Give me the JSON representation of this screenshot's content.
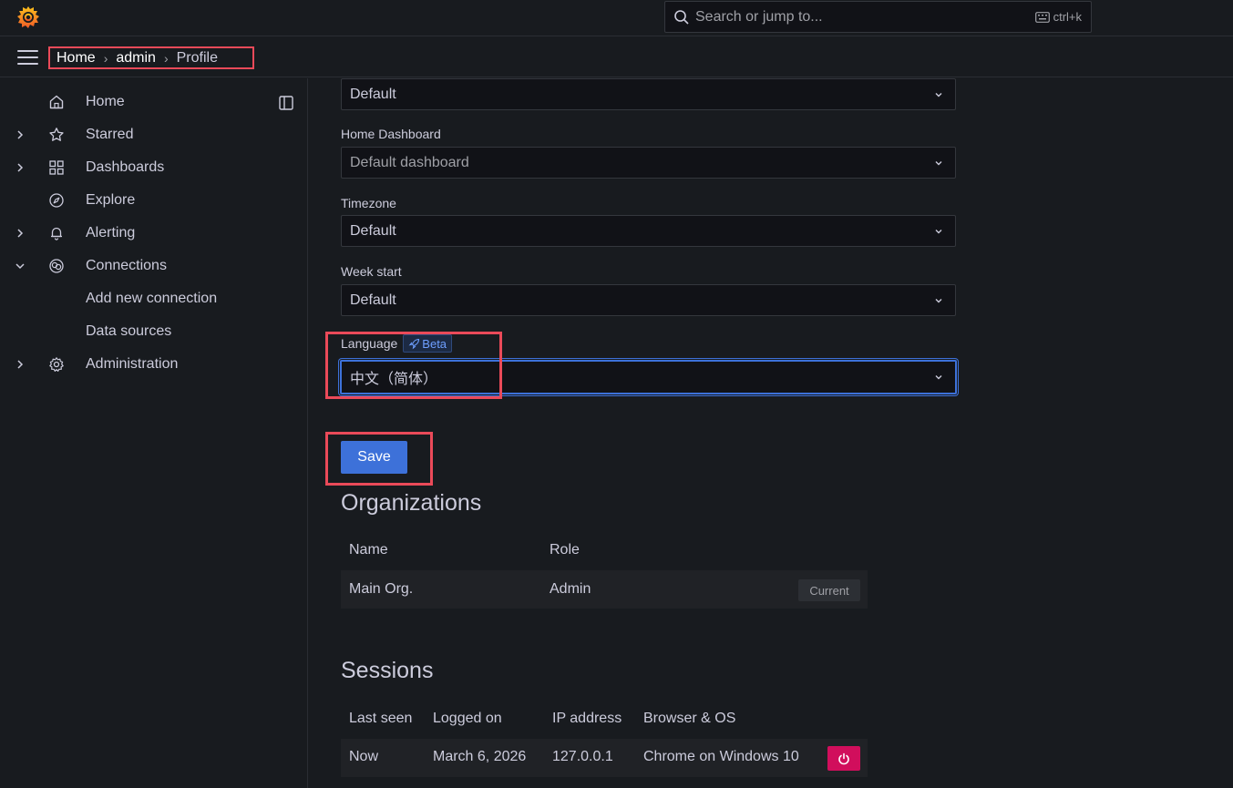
{
  "topbar": {
    "logo_icon": "grafana-logo",
    "search_placeholder": "Search or jump to...",
    "shortcut": "ctrl+k"
  },
  "breadcrumb": [
    "Home",
    "admin",
    "Profile"
  ],
  "sidebar": {
    "items": [
      {
        "label": "Home",
        "icon": "home-icon",
        "expandable": false
      },
      {
        "label": "Starred",
        "icon": "star-icon",
        "expandable": true
      },
      {
        "label": "Dashboards",
        "icon": "apps-icon",
        "expandable": true
      },
      {
        "label": "Explore",
        "icon": "compass-icon",
        "expandable": false
      },
      {
        "label": "Alerting",
        "icon": "bell-icon",
        "expandable": true
      },
      {
        "label": "Connections",
        "icon": "connections-icon",
        "expanded": true
      },
      {
        "label": "Add new connection"
      },
      {
        "label": "Data sources"
      },
      {
        "label": "Administration",
        "icon": "cog-icon",
        "expandable": true
      }
    ]
  },
  "preferences": {
    "theme_value": "Default",
    "home_dashboard_label": "Home Dashboard",
    "home_dashboard_placeholder": "Default dashboard",
    "timezone_label": "Timezone",
    "timezone_value": "Default",
    "week_start_label": "Week start",
    "week_start_value": "Default",
    "language_label": "Language",
    "language_badge": "Beta",
    "language_value": "中文（简体）",
    "save_label": "Save"
  },
  "organizations": {
    "heading": "Organizations",
    "columns": [
      "Name",
      "Role"
    ],
    "rows": [
      {
        "name": "Main Org.",
        "role": "Admin",
        "tag": "Current"
      }
    ]
  },
  "sessions": {
    "heading": "Sessions",
    "columns": [
      "Last seen",
      "Logged on",
      "IP address",
      "Browser & OS"
    ],
    "rows": [
      {
        "last_seen": "Now",
        "logged_on": "March 6, 2026",
        "ip": "127.0.0.1",
        "browser": "Chrome on Windows 10"
      }
    ]
  },
  "colors": {
    "accent": "#3d71d9",
    "highlight": "#ea4a59",
    "danger": "#d10e5c",
    "background": "#181b1f"
  }
}
